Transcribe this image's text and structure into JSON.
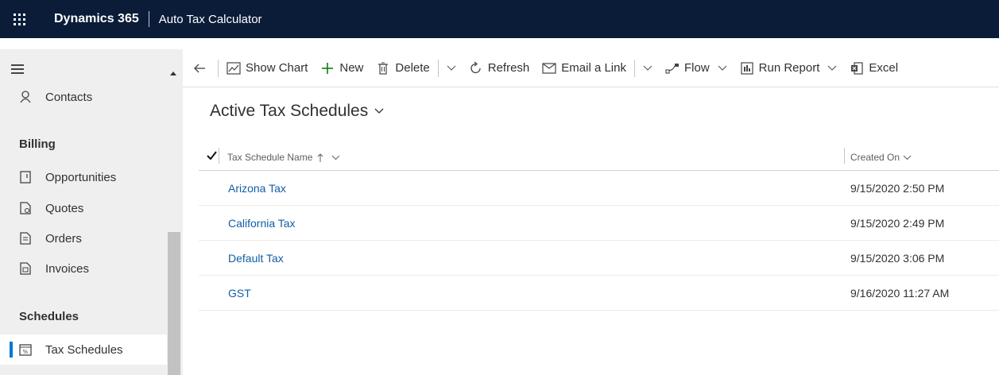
{
  "topbar": {
    "brand": "Dynamics 365",
    "app_name": "Auto Tax Calculator"
  },
  "sidebar": {
    "items_top": [
      {
        "label": "Contacts",
        "icon": "person-icon"
      }
    ],
    "group_billing": "Billing",
    "billing_items": [
      {
        "label": "Opportunities",
        "icon": "opportunity-icon"
      },
      {
        "label": "Quotes",
        "icon": "quote-icon"
      },
      {
        "label": "Orders",
        "icon": "order-icon"
      },
      {
        "label": "Invoices",
        "icon": "invoice-icon"
      }
    ],
    "group_schedules": "Schedules",
    "schedule_items": [
      {
        "label": "Tax Schedules",
        "icon": "tax-schedule-icon",
        "active": true
      }
    ]
  },
  "commandbar": {
    "show_chart": "Show Chart",
    "new": "New",
    "delete": "Delete",
    "refresh": "Refresh",
    "email_link": "Email a Link",
    "flow": "Flow",
    "run_report": "Run Report",
    "excel": "Excel"
  },
  "view": {
    "title": "Active Tax Schedules",
    "columns": {
      "name": "Tax Schedule Name",
      "created_on": "Created On"
    },
    "rows": [
      {
        "name": "Arizona Tax",
        "created_on": "9/15/2020 2:50 PM"
      },
      {
        "name": "California Tax",
        "created_on": "9/15/2020 2:49 PM"
      },
      {
        "name": "Default Tax",
        "created_on": "9/15/2020 3:06 PM"
      },
      {
        "name": "GST",
        "created_on": "9/16/2020 11:27 AM"
      }
    ]
  },
  "colors": {
    "topbar": "#0a1c38",
    "accent": "#0078d4",
    "link": "#115ea3"
  }
}
